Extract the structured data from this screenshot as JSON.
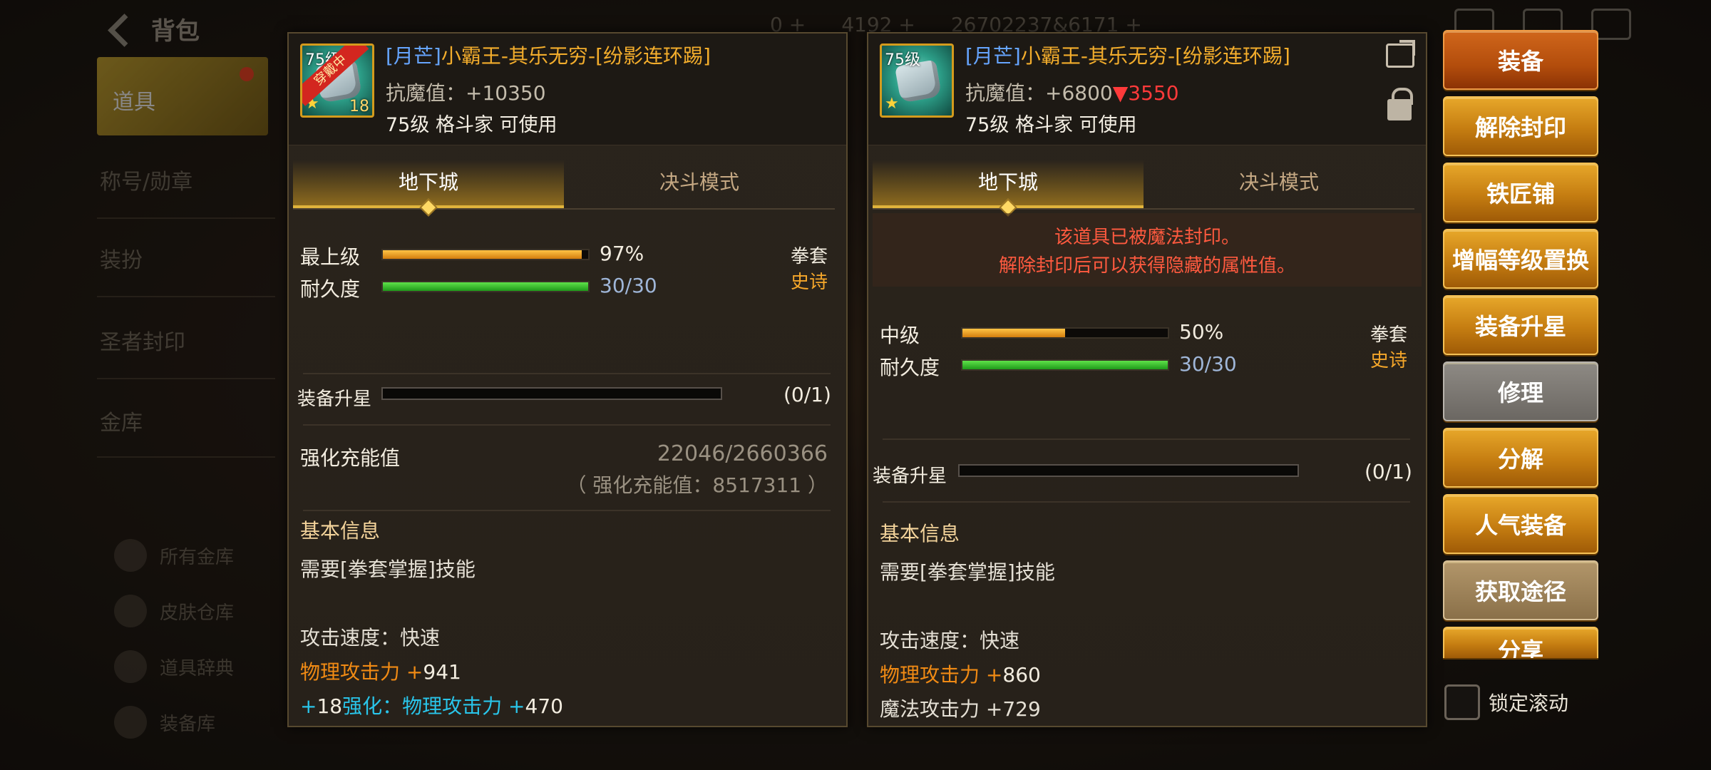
{
  "background": {
    "title": "背包",
    "top_stats": [
      "0 +",
      "4192 +",
      "26702237&6171 +"
    ],
    "side_nav": {
      "items": [
        "道具",
        "称号/勋章",
        "装扮",
        "圣者封印",
        "金库"
      ],
      "sub_items": [
        "所有金库",
        "皮肤仓库",
        "道具辞典",
        "装备库"
      ]
    }
  },
  "left_panel": {
    "icon": {
      "level": "75级",
      "count": "18",
      "ribbon": "穿戴中"
    },
    "name_prefix": "[月芒]",
    "name": "小霸王-其乐无穷-[纷影连环踢]",
    "resist_label": "抗魔值：",
    "resist_value": "+10350",
    "usable": "75级 格斗家 可使用",
    "tabs": [
      "地下城",
      "决斗模式"
    ],
    "grade_label": "最上级",
    "grade_pct": 97,
    "grade_text": "97%",
    "durability_label": "耐久度",
    "durability_pct": 100,
    "durability_text": "30/30",
    "item_type": "拳套",
    "rarity": "史诗",
    "star_label": "装备升星",
    "star_count": "(0/1)",
    "charge_label": "强化充能值",
    "charge_value": "22046/2660366",
    "charge_sub": "（ 强化充能值：8517311 ）",
    "basic_title": "基本信息",
    "skill_req": "需要[拳套掌握]技能",
    "atk_speed": "攻击速度：快速",
    "phys_atk_label": "物理攻击力 +",
    "phys_atk_value": "941",
    "enhance_plus": "+",
    "enhance_level": "18",
    "enhance_label": "强化：",
    "enhance_stat": "物理攻击力 +",
    "enhance_value": "470"
  },
  "right_panel": {
    "icon": {
      "level": "75级"
    },
    "name_prefix": "[月芒]",
    "name": "小霸王-其乐无穷-[纷影连环踢]",
    "resist_label": "抗魔值：",
    "resist_value": "+6800",
    "resist_diff": "▼3550",
    "usable": "75级 格斗家 可使用",
    "tabs": [
      "地下城",
      "决斗模式"
    ],
    "seal_line1": "该道具已被魔法封印。",
    "seal_line2": "解除封印后可以获得隐藏的属性值。",
    "grade_label": "中级",
    "grade_pct": 50,
    "grade_text": "50%",
    "durability_label": "耐久度",
    "durability_pct": 100,
    "durability_text": "30/30",
    "item_type": "拳套",
    "rarity": "史诗",
    "star_label": "装备升星",
    "star_count": "(0/1)",
    "basic_title": "基本信息",
    "skill_req": "需要[拳套掌握]技能",
    "atk_speed": "攻击速度：快速",
    "phys_atk_label": "物理攻击力 +",
    "phys_atk_value": "860",
    "magic_atk": "魔法攻击力 +729"
  },
  "actions": [
    "装备",
    "解除封印",
    "铁匠铺",
    "增幅等级置换",
    "装备升星",
    "修理",
    "分解",
    "人气装备",
    "获取途径",
    "分享"
  ],
  "lock_scroll_label": "锁定滚动"
}
